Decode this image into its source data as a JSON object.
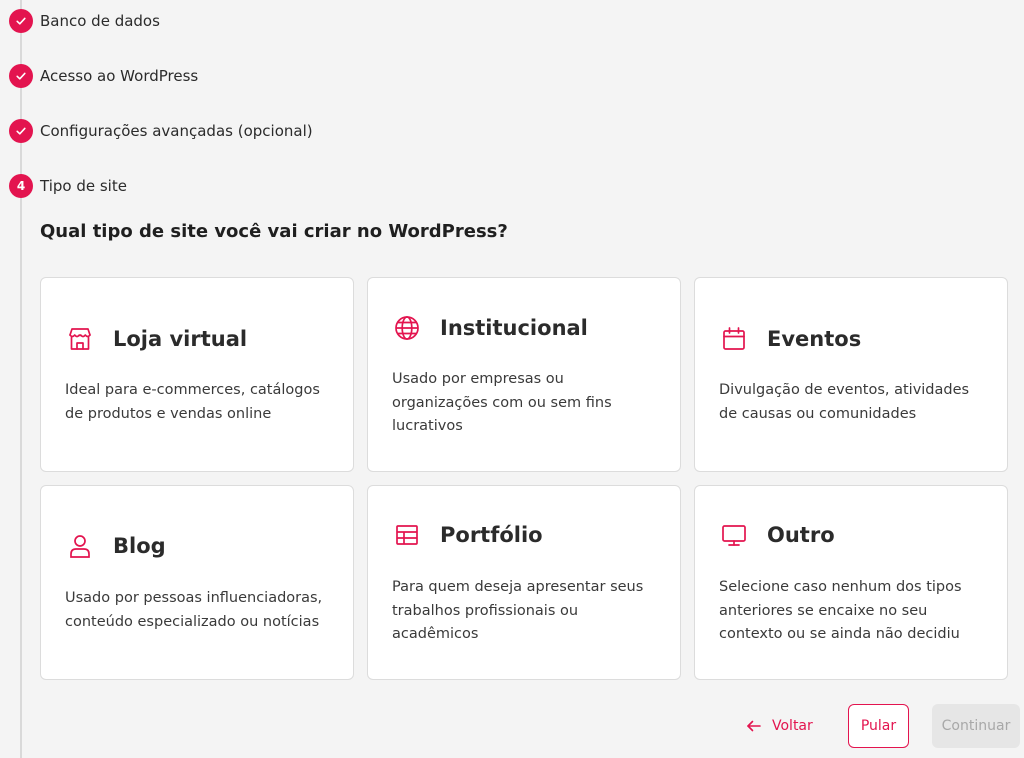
{
  "accent_color": "#e3144f",
  "steps": [
    {
      "label": "Banco de dados",
      "state": "completed",
      "icon": "check-icon"
    },
    {
      "label": "Acesso ao WordPress",
      "state": "completed",
      "icon": "check-icon"
    },
    {
      "label": "Configurações avançadas (opcional)",
      "state": "completed",
      "icon": "check-icon"
    },
    {
      "label": "Tipo de site",
      "state": "current",
      "number": "4"
    }
  ],
  "question": "Qual tipo de site você vai criar no WordPress?",
  "options": [
    {
      "title": "Loja virtual",
      "icon": "store-icon",
      "description": "Ideal para e-commerces, catálogos de produtos e vendas online"
    },
    {
      "title": "Institucional",
      "icon": "globe-icon",
      "description": "Usado por empresas ou organizações com ou sem fins lucrativos"
    },
    {
      "title": "Eventos",
      "icon": "calendar-icon",
      "description": "Divulgação de eventos, atividades de causas ou comunidades"
    },
    {
      "title": "Blog",
      "icon": "user-icon",
      "description": "Usado por pessoas influenciadoras, conteúdo especializado ou notícias"
    },
    {
      "title": "Portfólio",
      "icon": "layout-grid-icon",
      "description": "Para quem deseja apresentar seus trabalhos profissionais ou acadêmicos"
    },
    {
      "title": "Outro",
      "icon": "monitor-icon",
      "description": "Selecione caso nenhum dos tipos anteriores se encaixe no seu contexto ou se ainda não decidiu"
    }
  ],
  "actions": {
    "back_label": "Voltar",
    "skip_label": "Pular",
    "continue_label": "Continuar",
    "continue_disabled": true
  }
}
